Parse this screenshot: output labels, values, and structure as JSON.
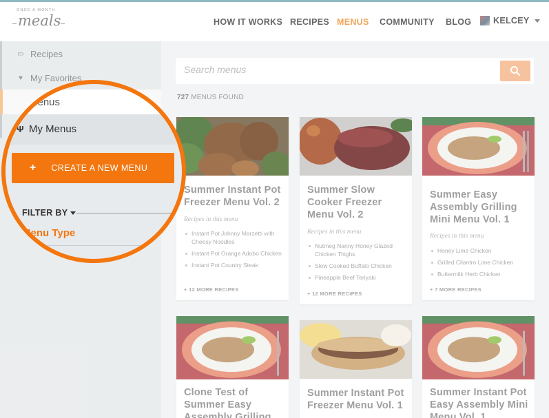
{
  "header": {
    "logo_small": "ONCE A MONTH",
    "logo_big": "meals",
    "nav": [
      "HOW IT WORKS",
      "RECIPES",
      "MENUS",
      "COMMUNITY",
      "BLOG"
    ],
    "active_nav": "MENUS",
    "user_name": "KELCEY"
  },
  "sidebar": {
    "items": [
      {
        "label": "Recipes",
        "icon": "recipes-icon"
      },
      {
        "label": "My Favorites",
        "icon": "heart-icon"
      },
      {
        "label": "Menus",
        "icon": "list-icon"
      },
      {
        "label": "My Menus",
        "icon": "fork-icon"
      }
    ],
    "create_button": "CREATE A NEW MENU",
    "create_plus": "+",
    "filter_by": "FILTER BY",
    "menu_type": "Menu Type"
  },
  "search": {
    "placeholder": "Search menus"
  },
  "results": {
    "count": "727",
    "count_label": "MENUS FOUND"
  },
  "cards": [
    {
      "title": "Summer Instant Pot Freezer Menu Vol. 2",
      "sub": "Recipes in this menu",
      "recipes": [
        "Instant Pot Johnny Marzetti with Cheesy Noodles",
        "Instant Pot Orange Adobo Chicken",
        "Instant Pot Country Steak"
      ],
      "more": "+ 12 MORE RECIPES"
    },
    {
      "title": "Summer Slow Cooker Freezer Menu Vol. 2",
      "sub": "Recipes in this menu",
      "recipes": [
        "Nutmeg Nanny Honey Glazed Chicken Thighs",
        "Slow Cooked Buffalo Chicken",
        "Pineapple Beef Teriyaki"
      ],
      "more": "+ 12 MORE RECIPES"
    },
    {
      "title": "Summer Easy Assembly Grilling Mini Menu Vol. 1",
      "sub": "Recipes in this menu",
      "recipes": [
        "Honey Lime Chicken",
        "Grilled Cilantro Lime Chicken",
        "Buttermilk Herb Chicken"
      ],
      "more": "+ 7 MORE RECIPES"
    },
    {
      "title": "Clone Test of Summer Easy Assembly Grilling"
    },
    {
      "title": "Summer Instant Pot Freezer Menu Vol. 1"
    },
    {
      "title": "Summer Instant Pot Easy Assembly Mini Menu Vol. 1"
    }
  ],
  "colors": {
    "accent": "#f3760f",
    "accent_faded": "#f2a45a",
    "topline": "#8fb9c2"
  }
}
